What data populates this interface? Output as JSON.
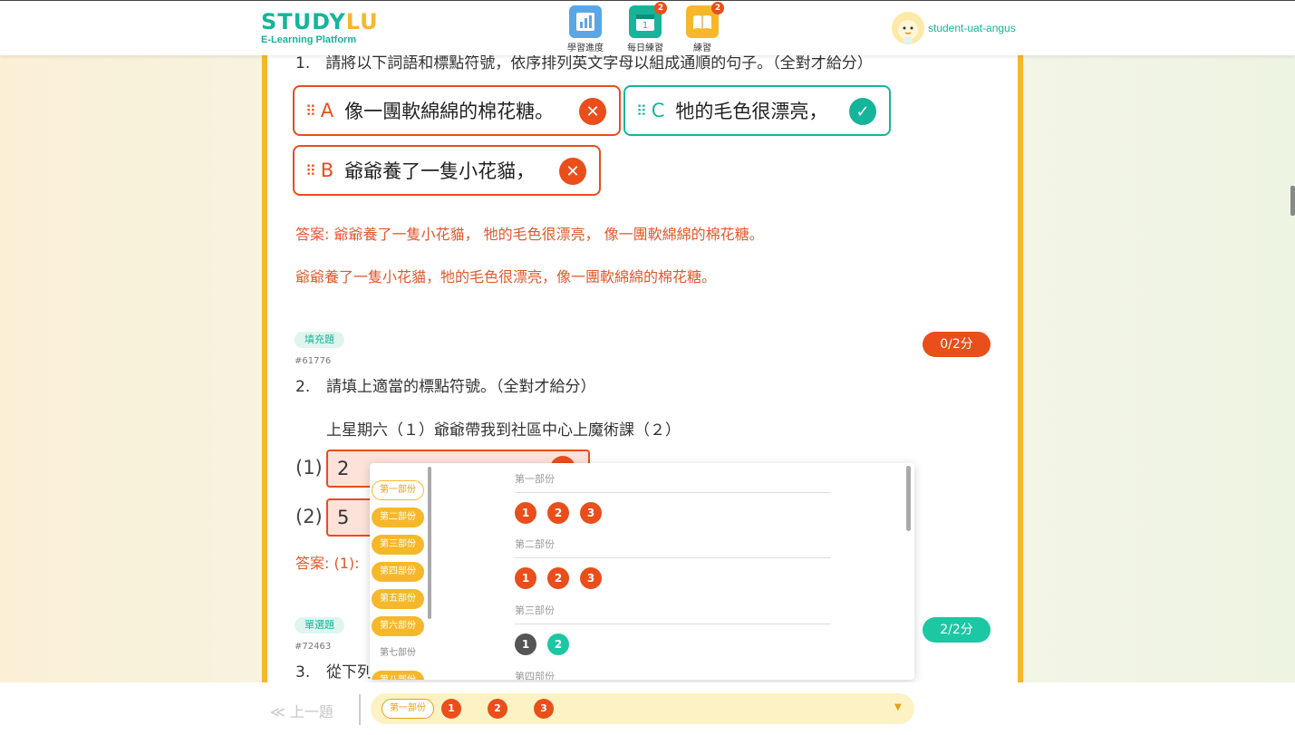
{
  "header": {
    "logo_main_a": "STUDY",
    "logo_main_b": "LU",
    "logo_sub": "E-Learning Platform",
    "nav": [
      {
        "label": "學習進度",
        "icon": "bar-chart-icon",
        "color": "#5aa7e8",
        "badge": ""
      },
      {
        "label": "每日練習",
        "icon": "calendar-icon",
        "color": "#16b59a",
        "badge": "2",
        "icon_text": "1"
      },
      {
        "label": "練習",
        "icon": "book-icon",
        "color": "#f6b82a",
        "badge": "2"
      }
    ],
    "username": "student-uat-angus"
  },
  "q1": {
    "title": "1.　請將以下詞語和標點符號，依序排列英文字母以組成通順的句子。（全對才給分）",
    "chips": [
      {
        "letter": "A",
        "text": "像一團軟綿綿的棉花糖。",
        "correct": false
      },
      {
        "letter": "C",
        "text": "牠的毛色很漂亮，",
        "correct": true
      },
      {
        "letter": "B",
        "text": "爺爺養了一隻小花貓，",
        "correct": false
      }
    ],
    "answer": "答案: 爺爺養了一隻小花貓， 牠的毛色很漂亮， 像一團軟綿綿的棉花糖。",
    "explanation": "爺爺養了一隻小花貓，牠的毛色很漂亮，像一團軟綿綿的棉花糖。"
  },
  "q2": {
    "type": "填充題",
    "id": "#61776",
    "score": "0/2分",
    "number": "2.",
    "text": "請填上適當的標點符號。（全對才給分）",
    "sentence": "上星期六（１）爺爺帶我到社區中心上魔術課（２）",
    "blanks": [
      {
        "label": "(1)",
        "value": "2"
      },
      {
        "label": "(2)",
        "value": "5"
      }
    ],
    "answer": "答案: (1):"
  },
  "q3": {
    "type": "單選題",
    "id": "#72463",
    "score": "2/2分",
    "number": "3.",
    "text": "從下列"
  },
  "navigator": {
    "sections": [
      {
        "label": "第一部份",
        "state": "current"
      },
      {
        "label": "第二部份",
        "state": "filled"
      },
      {
        "label": "第三部份",
        "state": "filled"
      },
      {
        "label": "第四部份",
        "state": "filled"
      },
      {
        "label": "第五部份",
        "state": "filled"
      },
      {
        "label": "第六部份",
        "state": "filled"
      },
      {
        "label": "第七部份",
        "state": "plain"
      },
      {
        "label": "第八部份",
        "state": "filled"
      }
    ],
    "parts": [
      {
        "title": "第一部份",
        "questions": [
          {
            "n": "1",
            "status": "wrong"
          },
          {
            "n": "2",
            "status": "wrong"
          },
          {
            "n": "3",
            "status": "wrong"
          }
        ]
      },
      {
        "title": "第二部份",
        "questions": [
          {
            "n": "1",
            "status": "wrong"
          },
          {
            "n": "2",
            "status": "wrong"
          },
          {
            "n": "3",
            "status": "wrong"
          }
        ]
      },
      {
        "title": "第三部份",
        "questions": [
          {
            "n": "1",
            "status": "dark"
          },
          {
            "n": "2",
            "status": "correct"
          }
        ]
      },
      {
        "title": "第四部份",
        "questions": []
      }
    ]
  },
  "footer": {
    "prev": "≪ 上一題",
    "current_section": "第一部份",
    "questions": [
      "1",
      "2",
      "3"
    ],
    "caret": "▼"
  }
}
